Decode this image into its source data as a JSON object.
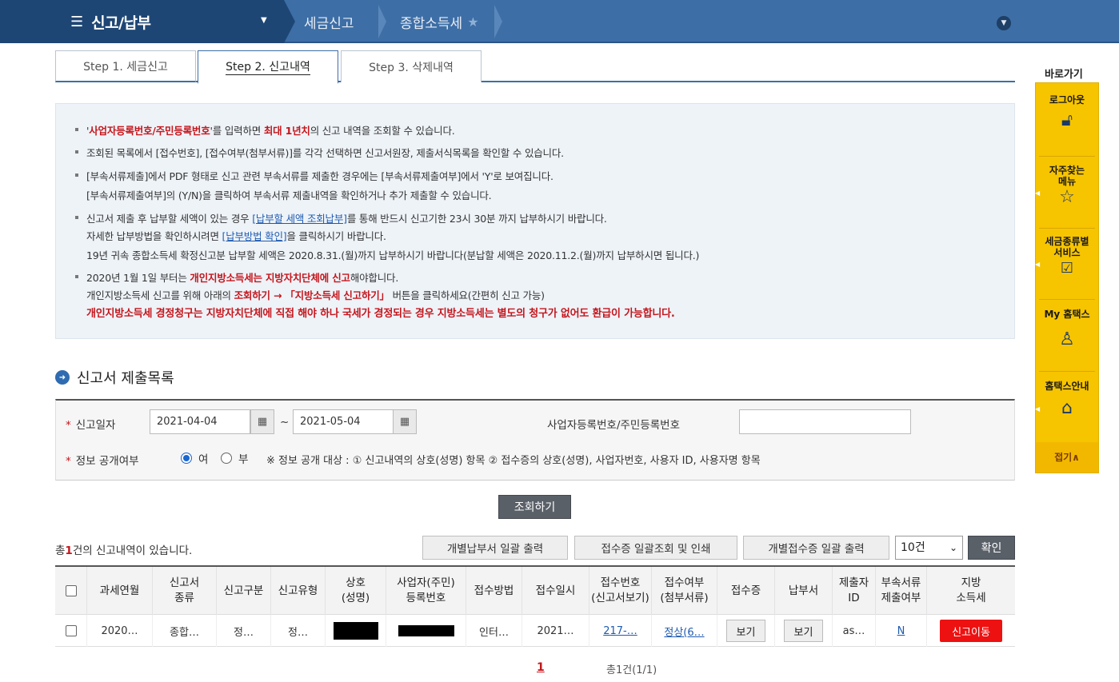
{
  "nav": {
    "menu_title": "신고/납부",
    "breadcrumb_1": "세금신고",
    "breadcrumb_2": "종합소득세"
  },
  "tabs": [
    {
      "label": "Step 1. 세금신고"
    },
    {
      "label": "Step 2. 신고내역"
    },
    {
      "label": "Step 3. 삭제내역"
    }
  ],
  "info": {
    "l1_a": "'",
    "l1_b": "사업자등록번호/주민등록번호",
    "l1_c": "'를 입력하면 ",
    "l1_d": "최대 1년치",
    "l1_e": "의 신고 내역을 조회할 수 있습니다.",
    "l2": "조회된 목록에서 [접수번호], [접수여부(첨부서류)]를 각각 선택하면 신고서원장, 제출서식목록을 확인할 수 있습니다.",
    "l3": "[부속서류제출]에서 PDF 형태로 신고 관련 부속서류를 제출한 경우에는 [부속서류제출여부]에서 'Y'로 보여집니다.",
    "l3b": "[부속서류제출여부]의 (Y/N)을 클릭하여 부속서류 제출내역을 확인하거나 추가 제출할 수 있습니다.",
    "l4_a": "신고서 제출 후 납부할 세액이 있는 경우 ",
    "l4_link": "[납부할 세액 조회납부]",
    "l4_b": "를 통해 반드시 신고기한 23시 30분 까지 납부하시기 바랍니다.",
    "l4b_a": "자세한 납부방법을 확인하시려면 ",
    "l4b_link": "[납부방법 확인]",
    "l4b_b": "을 클릭하시기 바랍니다.",
    "l4c": "19년 귀속 종합소득세 확정신고분 납부할 세액은 2020.8.31.(월)까지 납부하시기 바랍니다(분납할 세액은 2020.11.2.(월)까지 납부하시면 됩니다.)",
    "l5_a": "2020년 1월 1일 부터는 ",
    "l5_b": "개인지방소득세는 지방자치단체에 신고",
    "l5_c": "해야합니다.",
    "l5b_a": "개인지방소득세 신고를 위해 아래의 ",
    "l5b_b": "조회하기 → 「지방소득세 신고하기」",
    "l5b_c": " 버튼을 클릭하세요(간편히 신고 가능)",
    "l5c": "개인지방소득세 경정청구는 지방자치단체에 직접 해야 하나 국세가 경정되는 경우 지방소득세는 별도의 청구가 없어도 환급이 가능합니다."
  },
  "section": {
    "title": "신고서 제출목록"
  },
  "form": {
    "date_label": "신고일자",
    "date_from": "2021-04-04",
    "date_sep": "~",
    "date_to": "2021-05-04",
    "id_label": "사업자등록번호/주민등록번호",
    "id_value": "",
    "public_label": "정보 공개여부",
    "radio_yes": "여",
    "radio_no": "부",
    "selected": "yes",
    "public_note": "※ 정보 공개 대상 : ① 신고내역의 상호(성명) 항목 ② 접수증의 상호(성명), 사업자번호, 사용자 ID, 사용자명 항목"
  },
  "search_button": "조회하기",
  "list": {
    "summary_a": "총",
    "summary_count": "1",
    "summary_b": "건의 신고내역이 있습니다.",
    "btn_payment_print": "개별납부서 일괄 출력",
    "btn_receipt_view": "접수증 일괄조회 및 인쇄",
    "btn_receipt_print": "개별접수증 일괄 출력",
    "page_size": "10건",
    "btn_confirm": "확인"
  },
  "table": {
    "headers": [
      "",
      "과세연월",
      "신고서\n종류",
      "신고구분",
      "신고유형",
      "상호\n(성명)",
      "사업자(주민)\n등록번호",
      "접수방법",
      "접수일시",
      "접수번호\n(신고서보기)",
      "접수여부\n(첨부서류)",
      "접수증",
      "납부서",
      "제출자\nID",
      "부속서류\n제출여부",
      "지방\n소득세"
    ],
    "row": {
      "period": "2020…",
      "type": "종합…",
      "category": "정…",
      "kind": "정…",
      "method": "인터…",
      "datetime": "2021…",
      "receipt_no": "217-…",
      "status": "정상(6…",
      "receipt_btn": "보기",
      "payment_btn": "보기",
      "submitter": "as…",
      "attach": "N",
      "local_btn": "신고이동"
    }
  },
  "pager": {
    "current": "1",
    "total": "총1건(1/1)"
  },
  "quick": {
    "title": "바로가기",
    "items": [
      "로그아웃",
      "자주찾는\n메뉴",
      "세금종류별\n서비스",
      "My 홈택스",
      "홈택스안내"
    ],
    "collapse": "접기∧"
  },
  "colors": {
    "nav": "#3d6ea6",
    "nav_dark": "#1e4674",
    "accent_red": "#c4161c",
    "quick_yellow": "#f7c400"
  }
}
